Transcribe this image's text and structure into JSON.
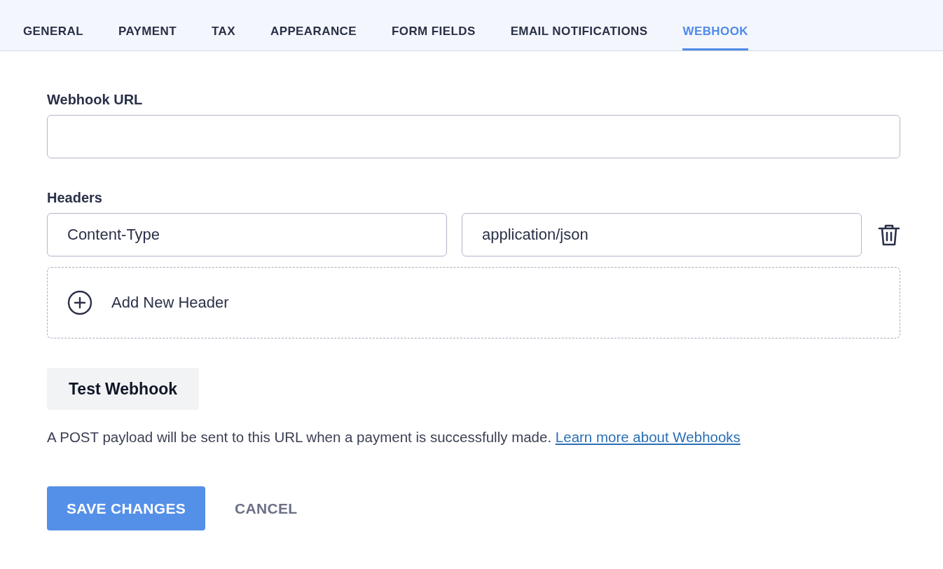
{
  "tabs": [
    {
      "label": "GENERAL",
      "selected": false
    },
    {
      "label": "PAYMENT",
      "selected": false
    },
    {
      "label": "TAX",
      "selected": false
    },
    {
      "label": "APPEARANCE",
      "selected": false
    },
    {
      "label": "FORM FIELDS",
      "selected": false
    },
    {
      "label": "EMAIL NOTIFICATIONS",
      "selected": false
    },
    {
      "label": "WEBHOOK",
      "selected": true
    }
  ],
  "webhook_url": {
    "label": "Webhook URL"
  },
  "headers": {
    "label": "Headers",
    "rows": [
      {
        "key": "Content-Type",
        "value": "application/json"
      }
    ],
    "add_button": "Add New Header"
  },
  "test_button": "Test Webhook",
  "help": {
    "text": "A POST payload will be sent to this URL when a payment is successfully made.",
    "link": "Learn more about Webhooks"
  },
  "actions": {
    "save": "SAVE CHANGES",
    "cancel": "CANCEL"
  }
}
